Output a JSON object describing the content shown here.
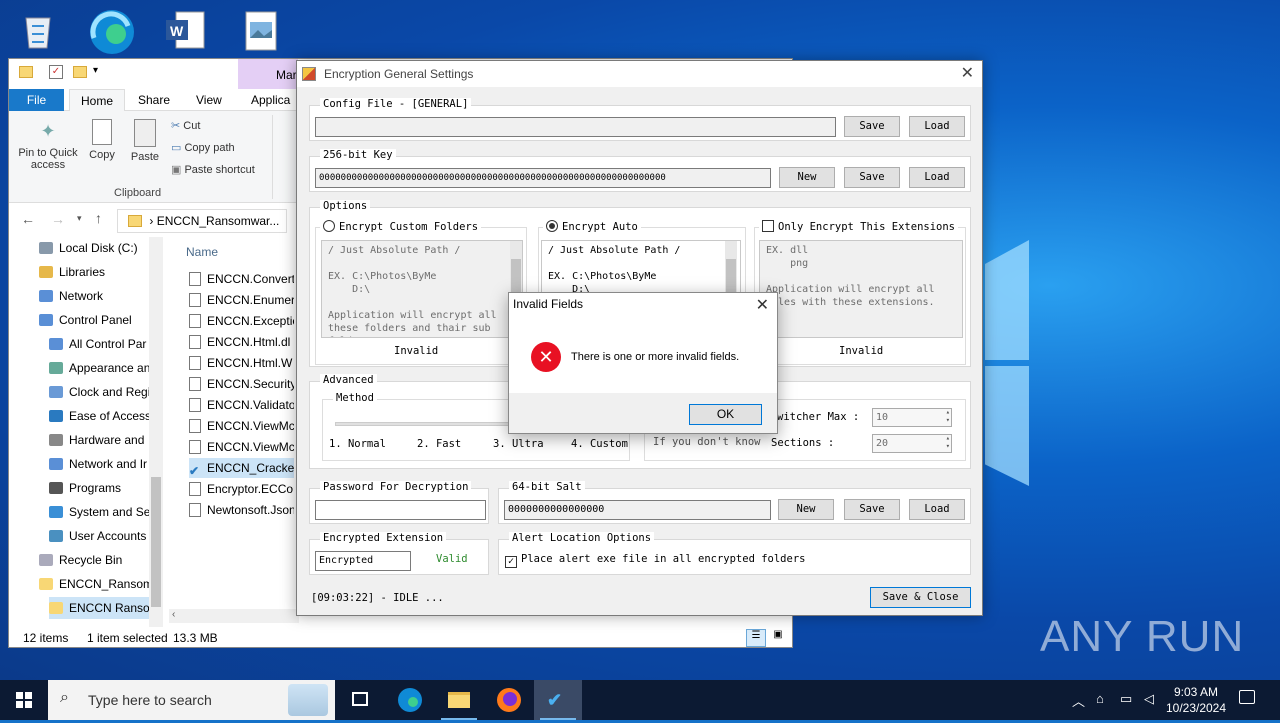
{
  "desktop": {
    "watermark": "ANY RUN",
    "icons": [
      "recycle-bin-icon",
      "edge-icon",
      "word-doc-icon",
      "image-file-icon"
    ]
  },
  "explorer": {
    "context_tab": "Mar",
    "tabs": [
      "File",
      "Home",
      "Share",
      "View",
      "Applica"
    ],
    "ribbon": {
      "pin": "Pin to Quick access",
      "copy": "Copy",
      "paste": "Paste",
      "cut": "Cut",
      "copy_path": "Copy path",
      "paste_shortcut": "Paste shortcut",
      "group_label": "Clipboard"
    },
    "address": "ENCCN_Ransomwar...",
    "nav_items": [
      "Local Disk (C:)",
      "Libraries",
      "Network",
      "Control Panel",
      "All Control Par",
      "Appearance an",
      "Clock and Regi",
      "Ease of Access",
      "Hardware and",
      "Network and Ir",
      "Programs",
      "System and Sec",
      "User Accounts",
      "Recycle Bin",
      "ENCCN_Ransom",
      "ENCCN Ranson"
    ],
    "column_header": "Name",
    "files": [
      "ENCCN.Convert",
      "ENCCN.Enumer",
      "ENCCN.Exceptic",
      "ENCCN.Html.dl",
      "ENCCN.Html.W",
      "ENCCN.Security",
      "ENCCN.Validato",
      "ENCCN.ViewMc",
      "ENCCN.ViewMc",
      "ENCCN_Cracked",
      "Encryptor.ECCo",
      "Newtonsoft.Json"
    ],
    "status": {
      "items": "12 items",
      "selected": "1 item selected",
      "size": "13.3 MB"
    }
  },
  "enc": {
    "title": "Encryption General Settings",
    "config": {
      "caption": "Config File - [GENERAL]",
      "value": "",
      "save": "Save",
      "load": "Load"
    },
    "key": {
      "caption": "256-bit Key",
      "value": "0000000000000000000000000000000000000000000000000000000000000000",
      "new": "New",
      "save": "Save",
      "load": "Load"
    },
    "options": {
      "caption": "Options",
      "custom_label": "Encrypt Custom Folders",
      "custom_text": "/ Just Absolute Path /\n\nEX. C:\\Photos\\ByMe\n    D:\\\n\nApplication will encrypt all\nthese folders and thair sub\nfolders",
      "custom_status": "Invalid",
      "auto_label": "Encrypt Auto",
      "auto_text": "/ Just Absolute Path /\n\nEX. C:\\Photos\\ByMe\n    D:\\",
      "ext_label": "Only Encrypt This Extensions",
      "ext_text": "EX. dll\n    png\n\nApplication will encrypt all\nfiles with these extensions.",
      "ext_status": "Invalid"
    },
    "advanced": {
      "caption": "Advanced",
      "method_caption": "Method",
      "methods": [
        "1. Normal",
        "2. Fast",
        "3. Ultra",
        "4. Custom"
      ],
      "hint": "If you don't know",
      "switcher_label": "witcher Max :",
      "switcher_value": "10",
      "sections_label": "Sections :",
      "sections_value": "20"
    },
    "password": {
      "caption": "Password For Decryption",
      "value": ""
    },
    "salt": {
      "caption": "64-bit Salt",
      "value": "0000000000000000",
      "new": "New",
      "save": "Save",
      "load": "Load"
    },
    "ext": {
      "caption": "Encrypted Extension",
      "value": "Encrypted",
      "status": "Valid"
    },
    "alert": {
      "caption": "Alert Location Options",
      "checkbox": "Place alert exe file in all encrypted folders"
    },
    "log": "[09:03:22] - IDLE ...",
    "save_close": "Save & Close"
  },
  "dialog": {
    "title": "Invalid Fields",
    "message": "There is one or more invalid fields.",
    "ok": "OK"
  },
  "taskbar": {
    "search": "Type here to search",
    "time": "9:03 AM",
    "date": "10/23/2024"
  },
  "colors": {
    "accent": "#0078d7",
    "error": "#e81123",
    "valid": "#2e8b2e",
    "taskbar": "#0c1a33"
  }
}
